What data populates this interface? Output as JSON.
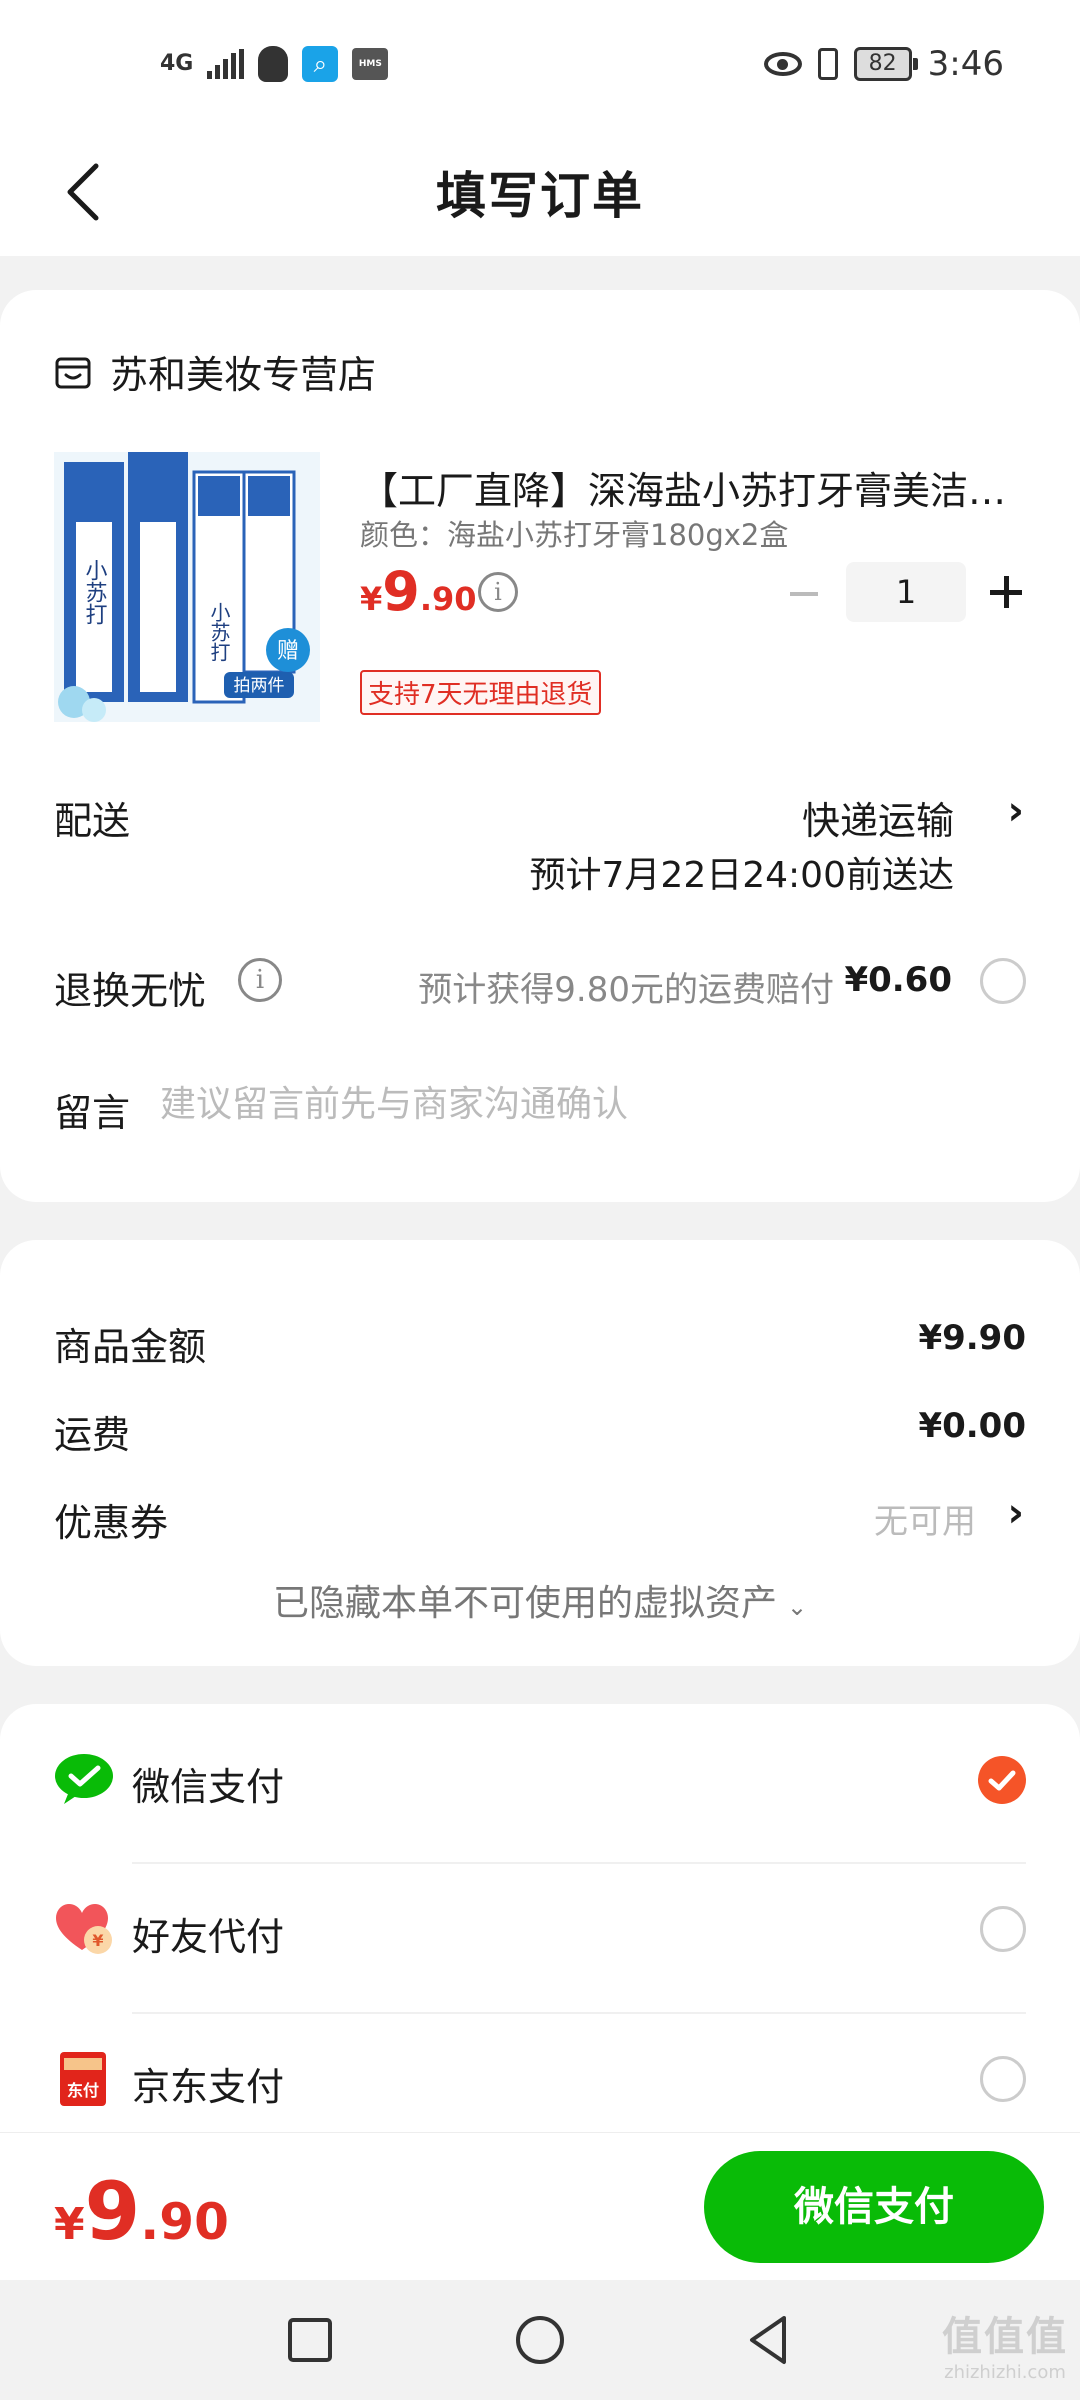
{
  "status_bar": {
    "network": "4G",
    "battery": "82",
    "time": "3:46",
    "icons": [
      "signal-icon",
      "qq-icon",
      "search-app-icon",
      "hms-icon",
      "eye-icon",
      "vibrate-icon",
      "battery-icon"
    ],
    "hms_label": "HMS"
  },
  "header": {
    "back_icon": "back-arrow-icon",
    "title": "填写订单"
  },
  "store": {
    "icon": "store-icon",
    "name": "苏和美妆专营店"
  },
  "product": {
    "title": "【工厂直降】深海盐小苏打牙膏美洁白去黄口臭清新口气",
    "spec": "颜色：海盐小苏打牙膏180gx2盒",
    "price_yen": "¥",
    "price_int": "9",
    "price_dec": ".90",
    "quantity": "1",
    "return_badge": "支持7天无理由退货",
    "image_text": {
      "brand": "小苏打",
      "badge": "拍两件",
      "gift": "赠"
    }
  },
  "delivery": {
    "label": "配送",
    "method": "快递运输",
    "estimate": "预计7月22日24:00前送达"
  },
  "return_insurance": {
    "label": "退换无忧",
    "desc": "预计获得9.80元的运费赔付",
    "price": "¥0.60"
  },
  "message": {
    "label": "留言",
    "placeholder": "建议留言前先与商家沟通确认"
  },
  "summary": {
    "goods_label": "商品金额",
    "goods_value": "¥9.90",
    "shipping_label": "运费",
    "shipping_value": "¥0.00",
    "coupon_label": "优惠券",
    "coupon_value": "无可用",
    "hidden_assets": "已隐藏本单不可使用的虚拟资产",
    "hidden_chevron": "⌄"
  },
  "payment_methods": [
    {
      "label": "微信支付",
      "icon": "wechat-pay-icon",
      "selected": true
    },
    {
      "label": "好友代付",
      "icon": "friend-pay-icon",
      "selected": false
    },
    {
      "label": "京东支付",
      "icon": "jd-pay-icon",
      "selected": false
    }
  ],
  "jd_icon_text": "东付",
  "friend_icon_text": "¥",
  "bottom_bar": {
    "total_yen": "¥",
    "total_int": "9",
    "total_dec": ".90",
    "pay_button": "微信支付"
  },
  "watermark": {
    "logo": "值值值",
    "site": "zhizhizhi.com"
  },
  "colors": {
    "price_red": "#e02e24",
    "pay_green": "#09bb07",
    "check_orange": "#f55428"
  }
}
